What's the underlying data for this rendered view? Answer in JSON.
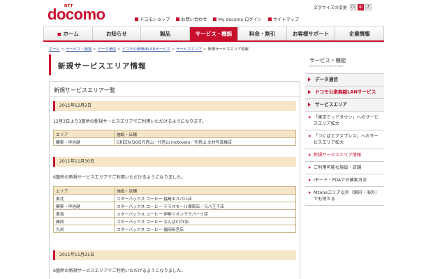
{
  "header": {
    "logo_ntt": "NTT",
    "logo_brand": "docomo",
    "text_size_label": "文字サイズの変更",
    "text_sizes": [
      "小",
      "中",
      "大"
    ],
    "utility_links": [
      "ドコモショップ",
      "お問い合わせ",
      "My docomo ログイン",
      "サイトマップ"
    ]
  },
  "global_nav": {
    "home_icon": "house-icon",
    "items": [
      "ホーム",
      "お知らせ",
      "製品",
      "サービス・機能",
      "料金・割引",
      "お客様サポート",
      "企業情報"
    ],
    "active_index": 3
  },
  "breadcrumb": [
    "ホーム",
    "サービス・機能",
    "データ通信",
    "ドコモ公衆無線LANサービス",
    "サービスエリア",
    "新規サービスエリア情報"
  ],
  "page_title": "新規サービスエリア情報",
  "section_title": "新規サービスエリア一覧",
  "updates": [
    {
      "date": "2011年12月2日",
      "notice": "12月3日より3箇所の新規サービスエリアでご利用いただけるようになります。",
      "col_area": "エリア",
      "col_facility": "施設・店舗",
      "rows": [
        {
          "area": "関東・甲信越",
          "facility": "GREEN DOG代官山／代官山 motovelo／代官山 北村写真機店"
        }
      ]
    },
    {
      "date": "2011年11月30日",
      "notice": "6箇所の新規サービスエリアでご利用いただけるようになりました。",
      "col_area": "エリア",
      "col_facility": "施設・店舗",
      "rows": [
        {
          "area": "東北",
          "facility": "スターバックス コーヒー 福島エスパル店"
        },
        {
          "area": "関東・甲信越",
          "facility": "スターバックス コーヒー テラスモール湘南店／元八王子店"
        },
        {
          "area": "東海",
          "facility": "スターバックス コーヒー 伊勢イオンララパーク店"
        },
        {
          "area": "関西",
          "facility": "スターバックス コーヒー なんばCITY店"
        },
        {
          "area": "九州",
          "facility": "スターバックス コーヒー 福岡新宮店"
        }
      ]
    },
    {
      "date": "2011年11月21日",
      "notice": "6箇所の新規サービスエリアでご利用いただけるようになりました。"
    }
  ],
  "sidebar": {
    "title": "サービス・機能",
    "subtitle": "SERVICES & FUNCTIONS",
    "items": [
      "データ通信",
      "ドコモ公衆無線LANサービス",
      "サービスエリア"
    ],
    "sub_items": [
      "「東京ミッドタウン」へのサービスエリア拡大",
      "「つくばエクスプレス」へのサービスエリア拡大",
      "新規サービスエリア情報",
      "ご利用可能な施設・店舗",
      "iモード・PDAでの検索方法",
      "Mzoneエリア以外（国内・海外）でも使える"
    ]
  },
  "colors": {
    "brand": "#c8102e",
    "table_header": "#f5e6c8"
  }
}
